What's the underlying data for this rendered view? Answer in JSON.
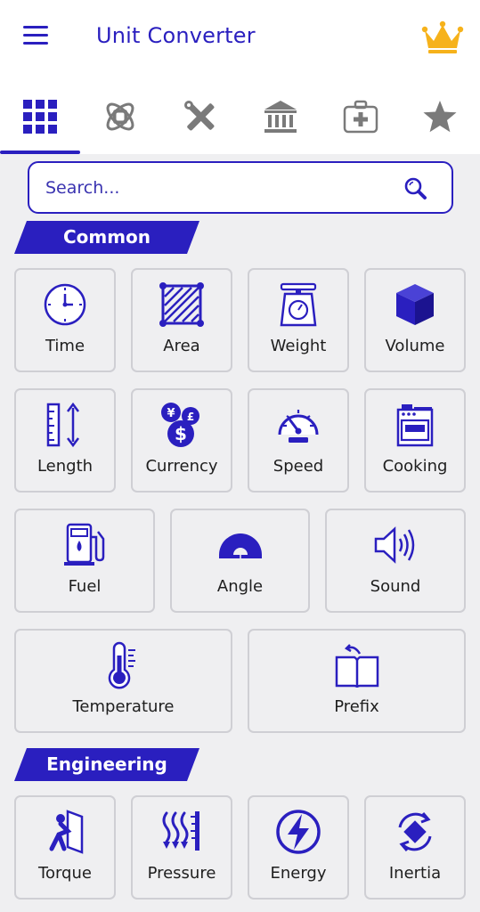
{
  "app": {
    "title": "Unit Converter"
  },
  "colors": {
    "accent": "#2a1fbf",
    "tab_inactive": "#7a7a7a",
    "crown": "#f6b21b",
    "card_border": "#cfcfd4",
    "background": "#efeff1"
  },
  "tabs": [
    {
      "icon": "grid-icon",
      "active": true
    },
    {
      "icon": "atom-icon",
      "active": false
    },
    {
      "icon": "tools-icon",
      "active": false
    },
    {
      "icon": "bank-icon",
      "active": false
    },
    {
      "icon": "medical-kit-icon",
      "active": false
    },
    {
      "icon": "star-icon",
      "active": false
    }
  ],
  "search": {
    "placeholder": "Search..."
  },
  "sections": {
    "common": {
      "label": "Common",
      "items": [
        {
          "label": "Time",
          "icon": "clock-icon"
        },
        {
          "label": "Area",
          "icon": "area-icon"
        },
        {
          "label": "Weight",
          "icon": "scale-icon"
        },
        {
          "label": "Volume",
          "icon": "cube-icon"
        },
        {
          "label": "Length",
          "icon": "ruler-icon"
        },
        {
          "label": "Currency",
          "icon": "currency-icon"
        },
        {
          "label": "Speed",
          "icon": "speedometer-icon"
        },
        {
          "label": "Cooking",
          "icon": "stove-icon"
        },
        {
          "label": "Fuel",
          "icon": "fuel-pump-icon"
        },
        {
          "label": "Angle",
          "icon": "protractor-icon"
        },
        {
          "label": "Sound",
          "icon": "speaker-icon"
        },
        {
          "label": "Temperature",
          "icon": "thermometer-icon"
        },
        {
          "label": "Prefix",
          "icon": "book-icon"
        }
      ]
    },
    "engineering": {
      "label": "Engineering",
      "items": [
        {
          "label": "Torque",
          "icon": "door-push-icon"
        },
        {
          "label": "Pressure",
          "icon": "pressure-icon"
        },
        {
          "label": "Energy",
          "icon": "lightning-icon"
        },
        {
          "label": "Inertia",
          "icon": "rotate-icon"
        }
      ]
    }
  }
}
